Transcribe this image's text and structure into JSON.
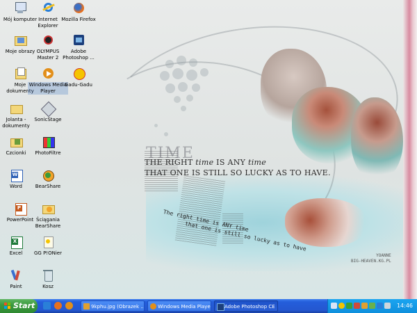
{
  "desktop": {
    "icons": [
      {
        "label": "Mój komputer",
        "name": "my-computer-icon"
      },
      {
        "label": "Internet Explorer",
        "name": "internet-explorer-icon"
      },
      {
        "label": "Mozilla Firefox",
        "name": "firefox-icon"
      },
      {
        "label": "Moje obrazy",
        "name": "my-pictures-icon"
      },
      {
        "label": "OLYMPUS Master 2",
        "name": "olympus-master-icon"
      },
      {
        "label": "Adobe Photoshop ...",
        "name": "photoshop-icon"
      },
      {
        "label": "Moje dokumenty",
        "name": "my-documents-icon"
      },
      {
        "label": "Windows Media Player",
        "name": "windows-media-player-icon"
      },
      {
        "label": "Gadu-Gadu",
        "name": "gadu-gadu-icon"
      },
      {
        "label": "Jolanta - dokumenty",
        "name": "jolanta-documents-icon"
      },
      {
        "label": "SonicStage",
        "name": "sonicstage-icon"
      },
      {
        "label": "Czcionki",
        "name": "fonts-folder-icon"
      },
      {
        "label": "PhotoFiltre",
        "name": "photofiltre-icon"
      },
      {
        "label": "Word",
        "name": "word-icon"
      },
      {
        "label": "BearShare",
        "name": "bearshare-icon"
      },
      {
        "label": "PowerPoint",
        "name": "powerpoint-icon"
      },
      {
        "label": "Ściągania BearShare",
        "name": "bearshare-downloads-icon"
      },
      {
        "label": "Excel",
        "name": "excel-icon"
      },
      {
        "label": "GG P!ONier",
        "name": "gg-pionier-icon"
      },
      {
        "label": "Paint",
        "name": "paint-icon"
      },
      {
        "label": "Kosz",
        "name": "recycle-bin-icon"
      }
    ],
    "wallpaper": {
      "time_word": "TIME",
      "quote_line1_a": "THE RIGHT ",
      "quote_line1_b": "time",
      "quote_line1_c": " IS ANY ",
      "quote_line1_d": "time",
      "quote_line2": "THAT ONE IS STILL SO LUCKY AS TO HAVE.",
      "quote_small_1": "The right time is ANY time",
      "quote_small_2": "that one is still so lucky as to have",
      "signature_1": "YOANNE",
      "signature_2": "BIG-HEAVEN.KG.PL"
    }
  },
  "taskbar": {
    "start_label": "Start",
    "tasks": [
      {
        "label": "9kphu.jpg (Obrazek ...",
        "name": "task-image-viewer"
      },
      {
        "label": "Windows Media Player",
        "name": "task-windows-media-player"
      },
      {
        "label": "Adobe Photoshop CE",
        "name": "task-photoshop"
      }
    ],
    "clock": "14:46"
  },
  "colors": {
    "taskbar": "#245edb",
    "start": "#3c9a3f",
    "tray": "#0f8fdd"
  }
}
